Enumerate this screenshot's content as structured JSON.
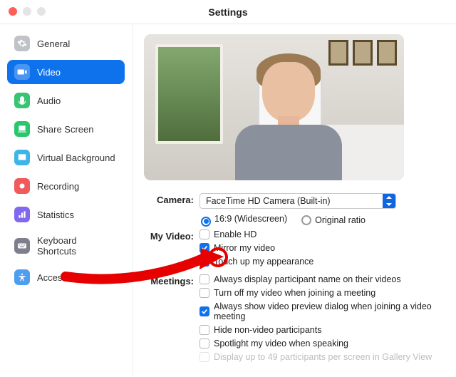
{
  "window": {
    "title": "Settings"
  },
  "sidebar": {
    "items": [
      {
        "label": "General",
        "icon": "gear-icon",
        "color": "#bfc2c7"
      },
      {
        "label": "Video",
        "icon": "video-icon",
        "color": "#0e72ed",
        "active": true
      },
      {
        "label": "Audio",
        "icon": "audio-icon",
        "color": "#37c473"
      },
      {
        "label": "Share Screen",
        "icon": "share-icon",
        "color": "#29c76c"
      },
      {
        "label": "Virtual Background",
        "icon": "background-icon",
        "color": "#3eb5e8"
      },
      {
        "label": "Recording",
        "icon": "recording-icon",
        "color": "#f05a5a"
      },
      {
        "label": "Statistics",
        "icon": "statistics-icon",
        "color": "#8069ef"
      },
      {
        "label": "Keyboard Shortcuts",
        "icon": "keyboard-icon",
        "color": "#7d7f8c"
      },
      {
        "label": "Accessibility",
        "icon": "accessibility-icon",
        "color": "#4e9ef0"
      }
    ]
  },
  "sections": {
    "camera_label": "Camera:",
    "my_video_label": "My Video:",
    "meetings_label": "Meetings:"
  },
  "camera": {
    "selected": "FaceTime HD Camera (Built-in)",
    "aspect": {
      "wide_label": "16:9 (Widescreen)",
      "orig_label": "Original ratio",
      "selected": "wide"
    }
  },
  "my_video": {
    "enable_hd": {
      "label": "Enable HD",
      "checked": false
    },
    "mirror": {
      "label": "Mirror my video",
      "checked": true
    },
    "touch_up": {
      "label": "Touch up my appearance",
      "checked": true
    }
  },
  "meetings": {
    "show_names": {
      "label": "Always display participant name on their videos",
      "checked": false
    },
    "off_on_join": {
      "label": "Turn off my video when joining a meeting",
      "checked": false
    },
    "preview_dialog": {
      "label": "Always show video preview dialog when joining a video meeting",
      "checked": true
    },
    "hide_nonvideo": {
      "label": "Hide non-video participants",
      "checked": false
    },
    "spotlight": {
      "label": "Spotlight my video when speaking",
      "checked": false
    },
    "gallery49": {
      "label": "Display up to 49 participants per screen in Gallery View",
      "checked": false,
      "disabled": true
    }
  }
}
